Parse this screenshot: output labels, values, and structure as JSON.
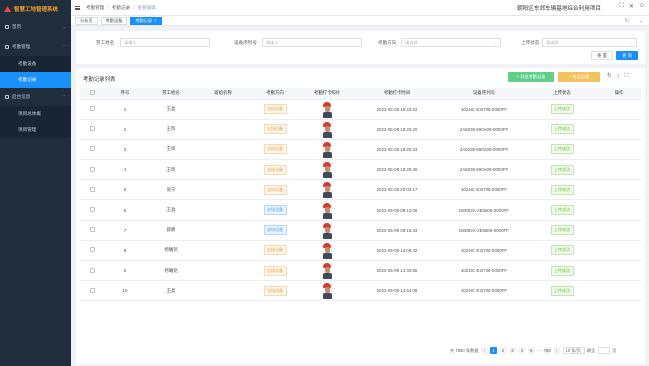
{
  "app": {
    "logo_text": "智慧工地管理系统"
  },
  "sidebar": {
    "items": [
      {
        "label": "首页",
        "icon": "home-icon"
      },
      {
        "label": "考勤管理",
        "icon": "user-icon"
      },
      {
        "label": "考勤设备",
        "sub": true
      },
      {
        "label": "考勤记录",
        "sub": true,
        "active": true
      },
      {
        "label": "后台信息",
        "icon": "info-icon"
      },
      {
        "label": "项目总体概",
        "sub": true
      },
      {
        "label": "项目管理",
        "sub": true
      }
    ]
  },
  "header": {
    "breadcrumbs": [
      "考勤管理",
      "考勤记录",
      "查看编辑"
    ],
    "project_name": "朝阳区东郊车辆基地综合利用项目"
  },
  "tabs": [
    {
      "label": "分析页"
    },
    {
      "label": "考勤设备"
    },
    {
      "label": "考勤记录",
      "active": true
    }
  ],
  "filter": {
    "name_label": "劳工姓名",
    "name_placeholder": "请输入",
    "device_label": "设备序列号",
    "device_placeholder": "请输入",
    "direction_label": "考勤方向",
    "direction_placeholder": "请选择",
    "upload_label": "上传状态",
    "upload_placeholder": "请选择",
    "reset_label": "重 置",
    "query_label": "查 询"
  },
  "panel": {
    "title": "考勤记录列表",
    "export_a": "+ 导出考勤记录",
    "export_b": "+ 导出日报"
  },
  "table": {
    "headers": [
      "序号",
      "劳工姓名",
      "班组名称",
      "考勤方向",
      "考勤打卡照片",
      "考勤打卡时间",
      "设备序列号",
      "上传状态",
      "操作"
    ],
    "rows": [
      {
        "no": "1",
        "name": "王晶",
        "team": "",
        "direction": "出场设备",
        "dir_type": "orange",
        "time": "2023-05-08 15:43:22",
        "device": "4024IC-E3I708-0000FF",
        "status": "上传成功"
      },
      {
        "no": "2",
        "name": "王辉",
        "team": "",
        "direction": "出场设备",
        "dir_type": "orange",
        "time": "2023-05-08 18:25:20",
        "device": "2A6039-590A08-0000FF",
        "status": "上传成功"
      },
      {
        "no": "3",
        "name": "王辉",
        "team": "",
        "direction": "出场设备",
        "dir_type": "orange",
        "time": "2023-05-08 18:25:23",
        "device": "2A6039-590A08-0000FF",
        "status": "上传成功"
      },
      {
        "no": "4",
        "name": "王辉",
        "team": "",
        "direction": "出场设备",
        "dir_type": "orange",
        "time": "2023-05-08 18:25:46",
        "device": "2A6039-590A08-0000FF",
        "status": "上传成功"
      },
      {
        "no": "5",
        "name": "张宁",
        "team": "",
        "direction": "出场设备",
        "dir_type": "orange",
        "time": "2023-05-08 20:00:17",
        "device": "4024IC-E3I708-0000FF",
        "status": "上传成功"
      },
      {
        "no": "6",
        "name": "王晶",
        "team": "",
        "direction": "进场设备",
        "dir_type": "blue",
        "time": "2023-05-09 09:10:06",
        "device": "D8D82A-2E5606-0000FF",
        "status": "上传成功"
      },
      {
        "no": "7",
        "name": "薛鹏",
        "team": "",
        "direction": "进场设备",
        "dir_type": "blue",
        "time": "2023-05-09 09:16:43",
        "device": "D8D82A-2E5606-0000FF",
        "status": "上传成功"
      },
      {
        "no": "8",
        "name": "杨曦铭",
        "team": "",
        "direction": "出场设备",
        "dir_type": "orange",
        "time": "2023-05-09 14:08:42",
        "device": "4024IC-E3I708-0000FF",
        "status": "上传成功"
      },
      {
        "no": "9",
        "name": "杨曦铭",
        "team": "",
        "direction": "出场设备",
        "dir_type": "orange",
        "time": "2023-05-09 14:40:56",
        "device": "4024IC-E3I708-0000FF",
        "status": "上传成功"
      },
      {
        "no": "10",
        "name": "王晶",
        "team": "",
        "direction": "出场设备",
        "dir_type": "orange",
        "time": "2023-05-09 14:54:08",
        "device": "4024IC-E3I708-0000FF",
        "status": "上传成功"
      }
    ]
  },
  "pager": {
    "total": "共 7860 条数据",
    "pages": [
      "1",
      "2",
      "3",
      "4",
      "5",
      "···",
      "786"
    ],
    "page_size": "10 条/页",
    "jump_label": "跳至",
    "page_unit": "页"
  },
  "colors": {
    "primary": "#1890ff",
    "sidebar_bg": "#1f2d3d",
    "logo": "#f0a020"
  }
}
